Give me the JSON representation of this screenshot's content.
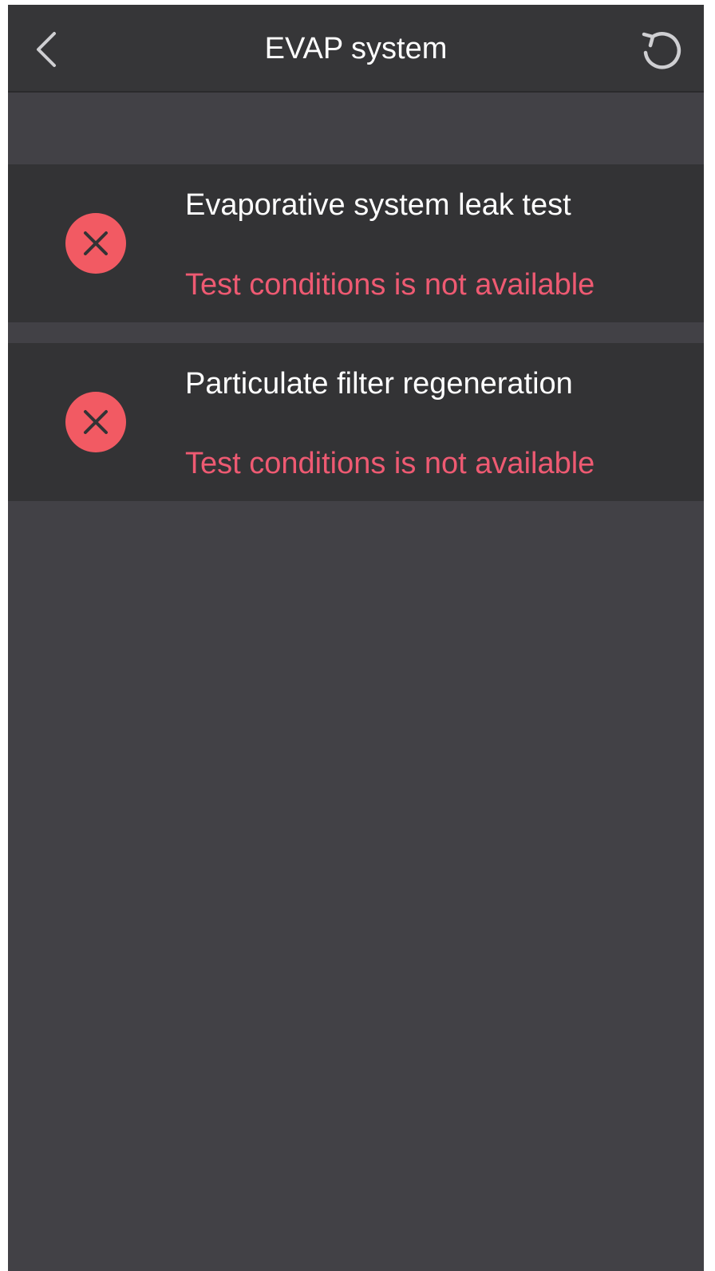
{
  "header": {
    "title": "EVAP system",
    "back_icon": "chevron-left-icon",
    "refresh_icon": "refresh-icon"
  },
  "colors": {
    "background": "#424146",
    "header_background": "#363638",
    "row_background": "#333335",
    "error_icon": "#f25a63",
    "error_text": "#ee5a72",
    "text": "#ffffff"
  },
  "tests": [
    {
      "name": "Evaporative system leak test",
      "status": "Test conditions is not available",
      "status_icon": "error-x-icon"
    },
    {
      "name": "Particulate filter regeneration",
      "status": "Test conditions is not available",
      "status_icon": "error-x-icon"
    }
  ]
}
